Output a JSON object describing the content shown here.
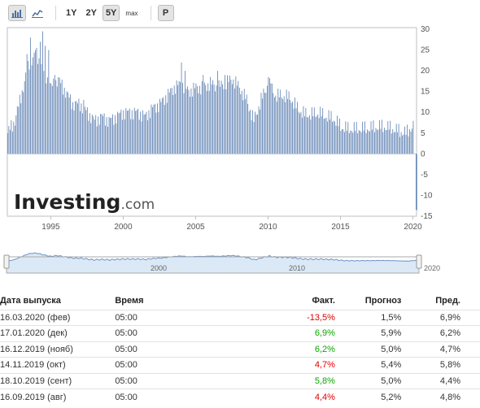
{
  "toolbar": {
    "bar_icon": "bar-chart-icon",
    "line_icon": "line-chart-icon",
    "ranges": [
      "1Y",
      "2Y",
      "5Y",
      "max"
    ],
    "active_range": "5Y",
    "p_label": "P"
  },
  "watermark": "Investing",
  "watermark_suffix": ".com",
  "colors": {
    "bar": "#5b7fb1",
    "axis": "#bfbfbf",
    "navigator_fill": "#dbe9f7",
    "navigator_line": "#6e93c4",
    "positive": "#0ea600",
    "negative": "#e30000"
  },
  "navigator": {
    "labels": [
      "2000",
      "2010",
      "2020"
    ]
  },
  "table": {
    "headers": [
      "Дата выпуска",
      "Время",
      "Факт.",
      "Прогноз",
      "Пред."
    ],
    "rows": [
      {
        "date": "16.03.2020 (фев)",
        "time": "05:00",
        "actual": "-13,5%",
        "forecast": "1,5%",
        "previous": "6,9%",
        "status": "neg"
      },
      {
        "date": "17.01.2020 (дек)",
        "time": "05:00",
        "actual": "6,9%",
        "forecast": "5,9%",
        "previous": "6,2%",
        "status": "pos"
      },
      {
        "date": "16.12.2019 (нояб)",
        "time": "05:00",
        "actual": "6,2%",
        "forecast": "5,0%",
        "previous": "4,7%",
        "status": "pos"
      },
      {
        "date": "14.11.2019 (окт)",
        "time": "05:00",
        "actual": "4,7%",
        "forecast": "5,4%",
        "previous": "5,8%",
        "status": "neg"
      },
      {
        "date": "18.10.2019 (сент)",
        "time": "05:00",
        "actual": "5,8%",
        "forecast": "5,0%",
        "previous": "4,4%",
        "status": "pos"
      },
      {
        "date": "16.09.2019 (авг)",
        "time": "05:00",
        "actual": "4,4%",
        "forecast": "5,2%",
        "previous": "4,8%",
        "status": "neg"
      }
    ]
  },
  "chart_data": {
    "type": "bar",
    "title": "",
    "xlabel": "",
    "ylabel": "",
    "ylim": [
      -15,
      30
    ],
    "yticks": [
      30,
      25,
      20,
      15,
      10,
      5,
      0,
      -5,
      -10,
      -15
    ],
    "xticks": [
      "1995",
      "2000",
      "2005",
      "2010",
      "2015",
      "2020"
    ],
    "x_range": [
      1992.0,
      2020.25
    ],
    "grid": false,
    "anchors": [
      [
        1992.0,
        5
      ],
      [
        1992.5,
        8
      ],
      [
        1993.0,
        15
      ],
      [
        1993.5,
        22
      ],
      [
        1994.0,
        24
      ],
      [
        1994.5,
        20
      ],
      [
        1995.0,
        16
      ],
      [
        1995.5,
        18
      ],
      [
        1996.0,
        15
      ],
      [
        1996.5,
        12
      ],
      [
        1997.0,
        12
      ],
      [
        1997.5,
        10
      ],
      [
        1998.0,
        8
      ],
      [
        1998.5,
        9
      ],
      [
        1999.0,
        8
      ],
      [
        1999.5,
        9
      ],
      [
        2000.0,
        10
      ],
      [
        2000.5,
        10
      ],
      [
        2001.0,
        10
      ],
      [
        2001.5,
        9
      ],
      [
        2002.0,
        11
      ],
      [
        2002.5,
        12
      ],
      [
        2003.0,
        14
      ],
      [
        2003.5,
        16
      ],
      [
        2004.0,
        17
      ],
      [
        2004.5,
        15
      ],
      [
        2005.0,
        16
      ],
      [
        2005.5,
        16
      ],
      [
        2006.0,
        17
      ],
      [
        2006.5,
        16
      ],
      [
        2007.0,
        17
      ],
      [
        2007.5,
        18
      ],
      [
        2008.0,
        16
      ],
      [
        2008.5,
        13
      ],
      [
        2009.0,
        8
      ],
      [
        2009.5,
        13
      ],
      [
        2010.0,
        17
      ],
      [
        2010.5,
        14
      ],
      [
        2011.0,
        14
      ],
      [
        2011.5,
        13.5
      ],
      [
        2012.0,
        11
      ],
      [
        2012.5,
        9.5
      ],
      [
        2013.0,
        9.5
      ],
      [
        2013.5,
        9.8
      ],
      [
        2014.0,
        9
      ],
      [
        2014.5,
        8.5
      ],
      [
        2015.0,
        6.5
      ],
      [
        2015.5,
        6
      ],
      [
        2016.0,
        6
      ],
      [
        2016.5,
        6.1
      ],
      [
        2017.0,
        6.2
      ],
      [
        2017.5,
        6.5
      ],
      [
        2018.0,
        6.5
      ],
      [
        2018.5,
        6.2
      ],
      [
        2019.0,
        5.5
      ],
      [
        2019.5,
        5
      ],
      [
        2019.9,
        6.5
      ]
    ],
    "spikes": [
      [
        1993.6,
        28
      ],
      [
        1994.25,
        27
      ],
      [
        1994.4,
        29.5
      ],
      [
        1994.55,
        26
      ],
      [
        1993.95,
        25
      ],
      [
        1993.3,
        24
      ],
      [
        1994.8,
        25
      ],
      [
        1995.25,
        19
      ],
      [
        1997.25,
        13
      ],
      [
        2004.0,
        22
      ],
      [
        2004.25,
        20
      ],
      [
        2006.5,
        20
      ],
      [
        2007.0,
        19
      ],
      [
        2010.0,
        18.5
      ],
      [
        2010.2,
        17
      ],
      [
        2005.5,
        19
      ]
    ],
    "last_value": -13.5
  }
}
